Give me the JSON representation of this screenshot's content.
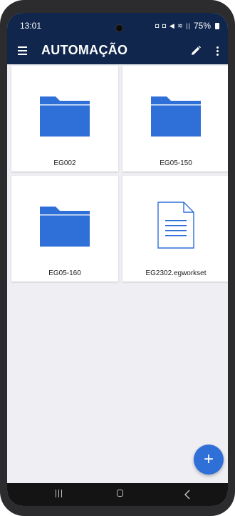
{
  "status_bar": {
    "time": "13:01",
    "icons_text": "◘ ◘ ◀ ≋ ||",
    "battery": "75%"
  },
  "app_bar": {
    "title": "AUTOMAÇÃO",
    "menu_icon": "hamburger-menu",
    "edit_icon": "pencil",
    "more_icon": "vertical-dots"
  },
  "items": [
    {
      "name": "EG002",
      "kind": "folder"
    },
    {
      "name": "EG05-150",
      "kind": "folder"
    },
    {
      "name": "EG05-160",
      "kind": "folder"
    },
    {
      "name": "EG2302.egworkset",
      "kind": "file"
    }
  ],
  "fab": {
    "label": "+"
  },
  "colors": {
    "app_bar": "#10264c",
    "folder": "#2f6fd8",
    "file": "#2f6fd8",
    "fab": "#2f6fd8",
    "background": "#efeff3"
  }
}
